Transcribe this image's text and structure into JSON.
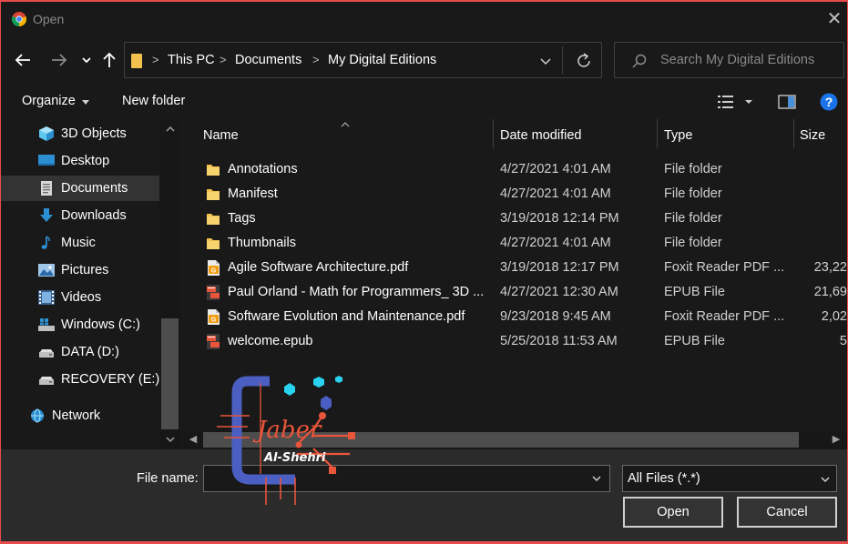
{
  "window": {
    "title": "Open",
    "close_glyph": "✕"
  },
  "address": {
    "crumbs": [
      "This PC",
      "Documents",
      "My Digital Editions"
    ]
  },
  "search": {
    "placeholder": "Search My Digital Editions"
  },
  "toolbar": {
    "organize_label": "Organize",
    "new_folder_label": "New folder"
  },
  "navpane": {
    "items": [
      {
        "label": "3D Objects",
        "icon": "3d-objects-icon"
      },
      {
        "label": "Desktop",
        "icon": "desktop-icon"
      },
      {
        "label": "Documents",
        "icon": "documents-icon",
        "selected": true
      },
      {
        "label": "Downloads",
        "icon": "downloads-icon"
      },
      {
        "label": "Music",
        "icon": "music-icon"
      },
      {
        "label": "Pictures",
        "icon": "pictures-icon"
      },
      {
        "label": "Videos",
        "icon": "videos-icon"
      },
      {
        "label": "Windows (C:)",
        "icon": "windows-drive-icon"
      },
      {
        "label": "DATA (D:)",
        "icon": "drive-icon"
      },
      {
        "label": "RECOVERY (E:)",
        "icon": "drive-icon"
      },
      {
        "label": "Network",
        "icon": "network-icon"
      }
    ]
  },
  "filelist": {
    "columns": {
      "name": "Name",
      "date": "Date modified",
      "type": "Type",
      "size": "Size"
    },
    "rows": [
      {
        "name": "Annotations",
        "date": "4/27/2021 4:01 AM",
        "type": "File folder",
        "size": "",
        "icon": "folder-icon"
      },
      {
        "name": "Manifest",
        "date": "4/27/2021 4:01 AM",
        "type": "File folder",
        "size": "",
        "icon": "folder-icon"
      },
      {
        "name": "Tags",
        "date": "3/19/2018 12:14 PM",
        "type": "File folder",
        "size": "",
        "icon": "folder-icon"
      },
      {
        "name": "Thumbnails",
        "date": "4/27/2021 4:01 AM",
        "type": "File folder",
        "size": "",
        "icon": "folder-icon"
      },
      {
        "name": "Agile Software Architecture.pdf",
        "date": "3/19/2018 12:17 PM",
        "type": "Foxit Reader PDF ...",
        "size": "23,22",
        "icon": "pdf-icon"
      },
      {
        "name": "Paul Orland - Math for Programmers_ 3D ...",
        "date": "4/27/2021 12:30 AM",
        "type": "EPUB File",
        "size": "21,69",
        "icon": "epub-icon"
      },
      {
        "name": "Software Evolution and Maintenance.pdf",
        "date": "9/23/2018 9:45 AM",
        "type": "Foxit Reader PDF ...",
        "size": "2,02",
        "icon": "pdf-icon"
      },
      {
        "name": "welcome.epub",
        "date": "5/25/2018 11:53 AM",
        "type": "EPUB File",
        "size": "5",
        "icon": "epub-icon"
      }
    ]
  },
  "bottom": {
    "filename_label": "File name:",
    "filename_value": "",
    "filter_selected": "All Files (*.*)",
    "open_label": "Open",
    "cancel_label": "Cancel"
  },
  "watermark": {
    "line1": "Jaber",
    "line2": "Al-Shehri"
  },
  "colors": {
    "accent_border": "#e74c4c",
    "folder": "#f2c14e",
    "help": "#1a73e8",
    "logo_blue": "#4a5fc1",
    "logo_red": "#e8553b",
    "logo_cyan": "#29d3f0"
  }
}
